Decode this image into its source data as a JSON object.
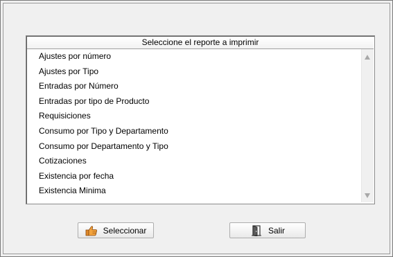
{
  "report_list": {
    "header": "Seleccione el reporte a imprimir",
    "items": [
      "Ajustes por número",
      "Ajustes por Tipo",
      "Entradas por Número",
      "Entradas por tipo de Producto",
      "Requisiciones",
      "Consumo por Tipo y Departamento",
      "Consumo por Departamento y Tipo",
      "Cotizaciones",
      "Existencia por fecha",
      "Existencia Minima"
    ]
  },
  "buttons": {
    "select_label": "Seleccionar",
    "select_icon": "thumbs-up-icon",
    "exit_label": "Salir",
    "exit_icon": "door-exit-icon"
  }
}
